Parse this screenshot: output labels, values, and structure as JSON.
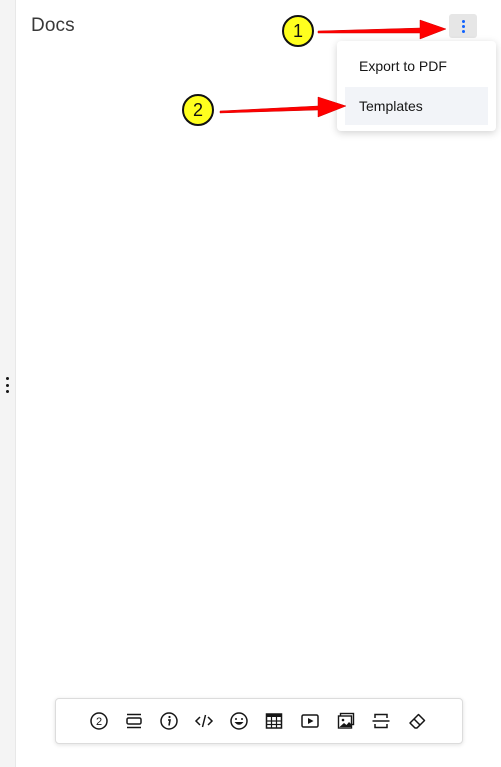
{
  "panel": {
    "title": "Docs"
  },
  "menu": {
    "items": [
      {
        "label": "Export to PDF"
      },
      {
        "label": "Templates"
      }
    ]
  },
  "annotations": {
    "marker_1": "1",
    "marker_2": "2"
  },
  "toolbar": {
    "tools": [
      {
        "icon": "numbered-circle-icon",
        "label": "2"
      },
      {
        "icon": "block-icon"
      },
      {
        "icon": "info-icon"
      },
      {
        "icon": "code-icon"
      },
      {
        "icon": "emoji-icon"
      },
      {
        "icon": "table-icon"
      },
      {
        "icon": "video-icon"
      },
      {
        "icon": "image-icon"
      },
      {
        "icon": "page-break-icon"
      },
      {
        "icon": "eraser-icon"
      }
    ]
  },
  "colors": {
    "accent": "#0f62fe",
    "marker_fill": "#ffff1e",
    "arrow": "#ff0000",
    "text": "#161616",
    "title": "#393939"
  }
}
